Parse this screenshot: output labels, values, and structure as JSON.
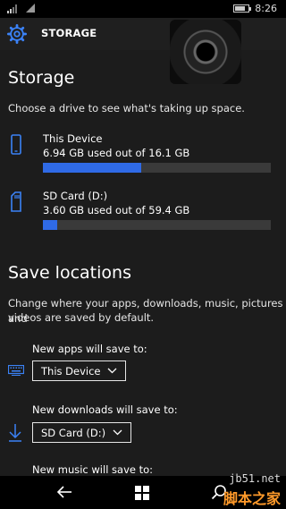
{
  "status_bar": {
    "time": "8:26"
  },
  "header": {
    "title": "STORAGE"
  },
  "storage": {
    "heading": "Storage",
    "description": "Choose a drive to see what's taking up space.",
    "drives": [
      {
        "name": "This Device",
        "usage": "6.94 GB used out of 16.1 GB",
        "used_fraction": 0.431
      },
      {
        "name": "SD Card (D:)",
        "usage": "3.60 GB used out of 59.4 GB",
        "used_fraction": 0.061
      }
    ]
  },
  "save_locations": {
    "heading": "Save locations",
    "description_line1": "Change where your apps, downloads, music, pictures and",
    "description_line2": "videos are saved by default.",
    "items": [
      {
        "label": "New apps will save to:",
        "value": "This Device",
        "icon": "keyboard-icon"
      },
      {
        "label": "New downloads will save to:",
        "value": "SD Card (D:)",
        "icon": "download-icon"
      },
      {
        "label": "New music will save to:"
      }
    ]
  },
  "navigation": {
    "icons": [
      "back-arrow-icon",
      "windows-start-icon",
      "search-icon"
    ]
  },
  "watermark": {
    "site": "jb51.net",
    "brand": "脚本之家"
  },
  "colors": {
    "accent": "#2f6ae6",
    "background": "#1c1c1c",
    "header": "#1f1f1f"
  }
}
